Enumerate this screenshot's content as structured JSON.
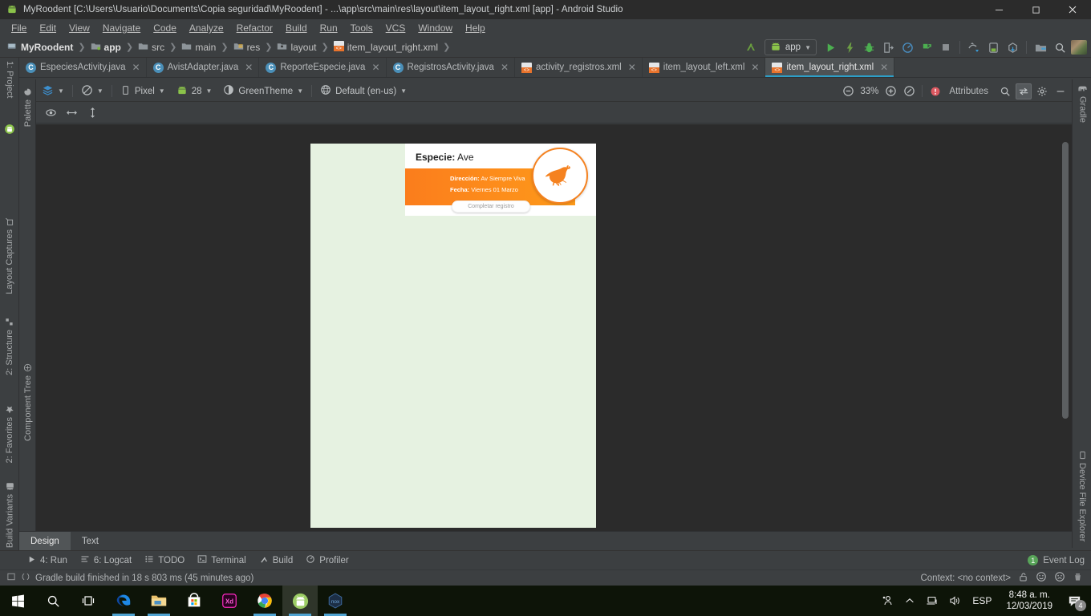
{
  "window": {
    "title": "MyRoodent [C:\\Users\\Usuario\\Documents\\Copia seguridad\\MyRoodent] - ...\\app\\src\\main\\res\\layout\\item_layout_right.xml [app] - Android Studio",
    "minimize": "─",
    "maximize": "❐",
    "close": "✕"
  },
  "menu": [
    {
      "label": "File"
    },
    {
      "label": "Edit"
    },
    {
      "label": "View"
    },
    {
      "label": "Navigate"
    },
    {
      "label": "Code"
    },
    {
      "label": "Analyze"
    },
    {
      "label": "Refactor"
    },
    {
      "label": "Build"
    },
    {
      "label": "Run"
    },
    {
      "label": "Tools"
    },
    {
      "label": "VCS"
    },
    {
      "label": "Window"
    },
    {
      "label": "Help"
    }
  ],
  "breadcrumb": [
    {
      "label": "MyRoodent",
      "icon": "module-icon"
    },
    {
      "label": "app",
      "icon": "app-module-icon"
    },
    {
      "label": "src",
      "icon": "folder-icon"
    },
    {
      "label": "main",
      "icon": "folder-icon"
    },
    {
      "label": "res",
      "icon": "res-folder-icon"
    },
    {
      "label": "layout",
      "icon": "layout-folder-icon"
    },
    {
      "label": "item_layout_right.xml",
      "icon": "xml-file-icon"
    }
  ],
  "nav_toolbar": {
    "run_config": "app",
    "buttons": [
      "back-icon",
      "run-icon",
      "apply-changes-icon",
      "debug-icon",
      "attach-debugger-icon",
      "profiler-icon",
      "run-with-coverage-icon",
      "stop-icon",
      "sync-gradle-icon",
      "avd-manager-icon",
      "sdk-manager-icon",
      "project-structure-icon",
      "search-icon",
      "user-avatar"
    ]
  },
  "editor_tabs": [
    {
      "label": "EspeciesActivity.java",
      "type": "java",
      "active": false
    },
    {
      "label": "AvistAdapter.java",
      "type": "java",
      "active": false
    },
    {
      "label": "ReporteEspecie.java",
      "type": "java",
      "active": false
    },
    {
      "label": "RegistrosActivity.java",
      "type": "java",
      "active": false
    },
    {
      "label": "activity_registros.xml",
      "type": "xml",
      "active": false
    },
    {
      "label": "item_layout_left.xml",
      "type": "xml",
      "active": false
    },
    {
      "label": "item_layout_right.xml",
      "type": "xml",
      "active": true
    }
  ],
  "left_rail": [
    {
      "label": "1: Project",
      "icon": "project-icon"
    },
    {
      "label": "Layout Captures",
      "icon": "layout-captures-icon"
    },
    {
      "label": "2: Structure",
      "icon": "structure-icon"
    },
    {
      "label": "2: Favorites",
      "icon": "favorites-star-icon"
    },
    {
      "label": "Build Variants",
      "icon": "build-variants-icon"
    }
  ],
  "left_rail2": [
    {
      "label": "Palette",
      "icon": "palette-icon"
    },
    {
      "label": "Component Tree",
      "icon": "component-tree-icon"
    }
  ],
  "right_rail": [
    {
      "label": "Gradle",
      "icon": "gradle-elephant-icon"
    },
    {
      "label": "Device File Explorer",
      "icon": "device-file-explorer-icon"
    }
  ],
  "design_toolbar": {
    "layers": "layers-icon",
    "orientation": "orientation-icon",
    "device": "Pixel",
    "api": "28",
    "theme": "GreenTheme",
    "locale": "Default (en-us)",
    "zoom_out": "zoom-out-icon",
    "zoom_level": "33%",
    "zoom_in": "zoom-in-icon",
    "zoom_fit": "zoom-to-fit-icon",
    "error_count_icon": "error-icon",
    "attributes_title": "Attributes",
    "search": "search-icon",
    "toggle": "toggle-attributes-icon",
    "settings": "gear-icon",
    "minimize": "minimize-icon"
  },
  "design_toolbar2": {
    "buttons": [
      "eye-visibility-icon",
      "horizontal-resize-icon",
      "vertical-resize-icon"
    ]
  },
  "preview": {
    "species_label": "Especie:",
    "species_value": "Ave",
    "address_label": "Dirección:",
    "address_value": "Av Siempre Viva",
    "date_label": "Fecha:",
    "date_value": "Viernes 01 Marzo",
    "button_label": "Completar registro",
    "bird_icon": "bird-silhouette-icon",
    "colors": {
      "background": "#e6f2e1",
      "orange": "#fb7d1c",
      "orange_light": "#fd9a1a",
      "card": "#ffffff"
    }
  },
  "editor_mode_tabs": [
    {
      "label": "Design",
      "active": true
    },
    {
      "label": "Text",
      "active": false
    }
  ],
  "bottom_bar": {
    "items": [
      {
        "label": "4: Run",
        "icon": "run-window-icon"
      },
      {
        "label": "6: Logcat",
        "icon": "logcat-icon"
      },
      {
        "label": "TODO",
        "icon": "todo-icon"
      },
      {
        "label": "Terminal",
        "icon": "terminal-icon"
      },
      {
        "label": "Build",
        "icon": "build-hammer-icon"
      },
      {
        "label": "Profiler",
        "icon": "profiler-icon"
      }
    ],
    "event_log_badge": "1",
    "event_log_label": "Event Log"
  },
  "status_bar": {
    "message": "Gradle build finished in 18 s 803 ms (45 minutes ago)",
    "context": "Context: <no context>",
    "icons": [
      "toggle-memory-icon",
      "progress-icon",
      "lock-icon",
      "smiley-happy-icon",
      "smiley-sad-icon",
      "trash-icon"
    ]
  },
  "taskbar": {
    "apps": [
      {
        "name": "start-button-icon"
      },
      {
        "name": "search-icon"
      },
      {
        "name": "task-view-icon"
      },
      {
        "name": "edge-icon"
      },
      {
        "name": "file-explorer-icon"
      },
      {
        "name": "microsoft-store-icon"
      },
      {
        "name": "adobe-xd-icon"
      },
      {
        "name": "chrome-icon"
      },
      {
        "name": "android-studio-icon"
      },
      {
        "name": "nox-player-icon"
      }
    ],
    "tray": {
      "people_icon": "people-icon",
      "chevron_icon": "show-hidden-icons-icon",
      "network_icon": "network-icon",
      "volume_icon": "volume-icon",
      "language": "ESP",
      "time": "8:48 a. m.",
      "date": "12/03/2019",
      "notification_count": "4"
    }
  }
}
